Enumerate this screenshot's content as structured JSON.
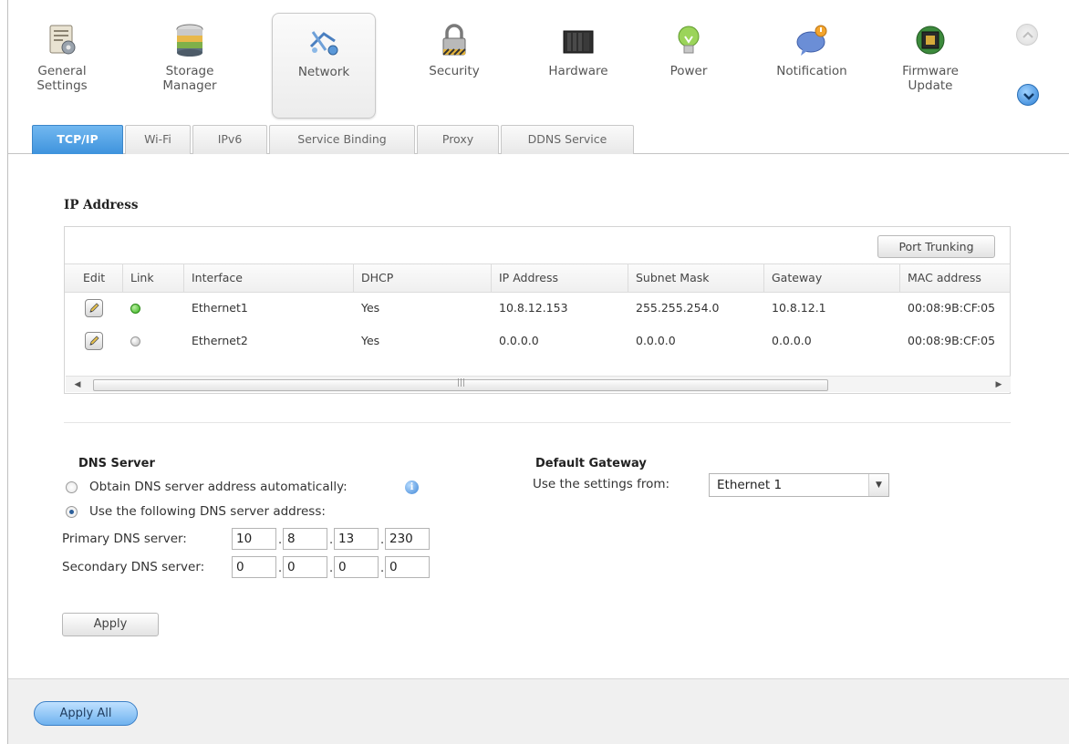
{
  "toolbar": {
    "items": [
      {
        "label": "General\nSettings",
        "icon": "settings-icon"
      },
      {
        "label": "Storage\nManager",
        "icon": "storage-icon"
      },
      {
        "label": "Network",
        "icon": "network-icon",
        "active": true
      },
      {
        "label": "Security",
        "icon": "lock-icon"
      },
      {
        "label": "Hardware",
        "icon": "hardware-icon"
      },
      {
        "label": "Power",
        "icon": "power-bulb-icon"
      },
      {
        "label": "Notification",
        "icon": "notification-icon"
      },
      {
        "label": "Firmware\nUpdate",
        "icon": "firmware-icon"
      }
    ]
  },
  "tabs": [
    {
      "label": "TCP/IP",
      "active": true
    },
    {
      "label": "Wi-Fi"
    },
    {
      "label": "IPv6"
    },
    {
      "label": "Service Binding"
    },
    {
      "label": "Proxy"
    },
    {
      "label": "DDNS Service"
    }
  ],
  "ip_section": {
    "title": "IP Address",
    "port_trunking_label": "Port Trunking",
    "columns": [
      "Edit",
      "Link",
      "Interface",
      "DHCP",
      "IP Address",
      "Subnet Mask",
      "Gateway",
      "MAC address"
    ],
    "rows": [
      {
        "link": "up",
        "interface": "Ethernet1",
        "dhcp": "Yes",
        "ip": "10.8.12.153",
        "mask": "255.255.254.0",
        "gateway": "10.8.12.1",
        "mac": "00:08:9B:CF:05"
      },
      {
        "link": "down",
        "interface": "Ethernet2",
        "dhcp": "Yes",
        "ip": "0.0.0.0",
        "mask": "0.0.0.0",
        "gateway": "0.0.0.0",
        "mac": "00:08:9B:CF:05"
      }
    ]
  },
  "dns": {
    "title": "DNS Server",
    "auto_label": "Obtain DNS server address automatically:",
    "manual_label": "Use the following DNS server address:",
    "selected": "manual",
    "primary_label": "Primary DNS server:",
    "primary": [
      "10",
      "8",
      "13",
      "230"
    ],
    "secondary_label": "Secondary DNS server:",
    "secondary": [
      "0",
      "0",
      "0",
      "0"
    ],
    "apply_label": "Apply"
  },
  "gateway": {
    "title": "Default Gateway",
    "use_label": "Use the settings from:",
    "selected": "Ethernet 1"
  },
  "footer": {
    "apply_all_label": "Apply All"
  },
  "colors": {
    "tab_active": "#3e93dd",
    "link_up": "#34b01a",
    "link_down": "#bbbbbb"
  }
}
